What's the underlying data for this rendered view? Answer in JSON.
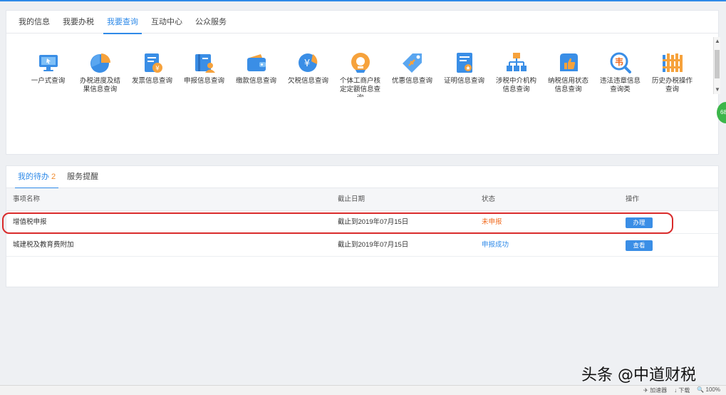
{
  "nav": {
    "tabs": [
      "我的信息",
      "我要办税",
      "我要查询",
      "互动中心",
      "公众服务"
    ],
    "active_index": 2
  },
  "query_icons": [
    {
      "label": "一户式查询",
      "icon": "monitor-icon",
      "color": "#3a8ee6"
    },
    {
      "label": "办税进度及结果信息查询",
      "icon": "pie-chart-icon",
      "color": "#3a8ee6"
    },
    {
      "label": "发票信息查询",
      "icon": "invoice-yen-icon",
      "color": "#3a8ee6"
    },
    {
      "label": "申报信息查询",
      "icon": "book-person-icon",
      "color": "#3a8ee6"
    },
    {
      "label": "缴款信息查询",
      "icon": "wallet-icon",
      "color": "#3a8ee6"
    },
    {
      "label": "欠税信息查询",
      "icon": "yen-coin-icon",
      "color": "#3a8ee6"
    },
    {
      "label": "个体工商户核定定额信息查询",
      "icon": "medal-icon",
      "color": "#f08a2c"
    },
    {
      "label": "优惠信息查询",
      "icon": "tag-icon",
      "color": "#3a8ee6"
    },
    {
      "label": "证明信息查询",
      "icon": "certificate-icon",
      "color": "#3a8ee6"
    },
    {
      "label": "涉税中介机构信息查询",
      "icon": "org-chart-icon",
      "color": "#f08a2c"
    },
    {
      "label": "纳税信用状态信息查询",
      "icon": "thumbs-up-icon",
      "color": "#3a8ee6"
    },
    {
      "label": "违法违章信息查询类",
      "icon": "violation-search-icon",
      "color": "#f08a2c"
    },
    {
      "label": "历史办税操作查询",
      "icon": "fence-history-icon",
      "color": "#f08a2c"
    }
  ],
  "tasks": {
    "tabs": [
      "我的待办",
      "服务提醒"
    ],
    "pending_count": "2",
    "headers": [
      "事项名称",
      "截止日期",
      "状态",
      "操作"
    ],
    "rows": [
      {
        "name": "增值税申报",
        "deadline": "截止到2019年07月15日",
        "status": "未申报",
        "action": "办理"
      },
      {
        "name": "城建税及教育费附加",
        "deadline": "截止到2019年07月15日",
        "status": "申报成功",
        "action": "查看"
      }
    ]
  },
  "badge": "68",
  "statusbar": {
    "items": [
      "加速器",
      "下载",
      "100%"
    ]
  },
  "watermark": "头条 @中道财税"
}
